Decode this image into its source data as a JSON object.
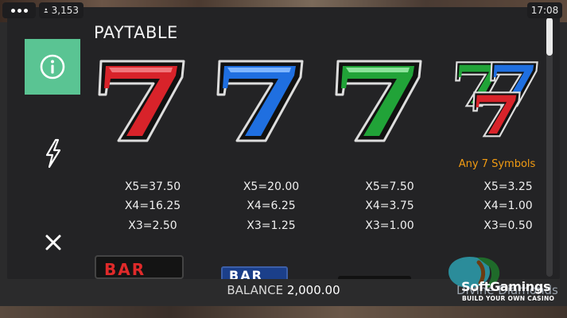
{
  "top_bar": {
    "players_count": "3,153",
    "clock": "17:08"
  },
  "paytable": {
    "title": "PAYTABLE",
    "columns": [
      {
        "symbol": "red-seven",
        "color": "#d8232a",
        "label": "",
        "x5": "X5=37.50",
        "x4": "X4=16.25",
        "x3": "X3=2.50"
      },
      {
        "symbol": "blue-seven",
        "color": "#1f6fe0",
        "label": "",
        "x5": "X5=20.00",
        "x4": "X4=6.25",
        "x3": "X3=1.25"
      },
      {
        "symbol": "green-seven",
        "color": "#21a338",
        "label": "",
        "x5": "X5=7.50",
        "x4": "X4=3.75",
        "x3": "X3=1.00"
      },
      {
        "symbol": "any-seven",
        "color": "#f39c12",
        "label": "Any 7 Symbols",
        "x5": "X5=3.25",
        "x4": "X4=1.00",
        "x3": "X3=0.50"
      }
    ],
    "next_row": {
      "red_bar_text": "BAR",
      "blue_bar_text": "BAR"
    }
  },
  "sidebar": {
    "info_icon": "info-icon",
    "lightning_icon": "lightning-icon",
    "close_icon": "close-icon"
  },
  "footer": {
    "balance_label": "BALANCE",
    "balance_value": "2,000.00",
    "game_name": "Divine Diamonds"
  },
  "brand": {
    "name": "SoftGamings",
    "tagline": "BUILD YOUR OWN CASINO"
  },
  "colors": {
    "accent_green": "#5ac493",
    "label_orange": "#f39c12",
    "panel_bg": "#232325"
  }
}
